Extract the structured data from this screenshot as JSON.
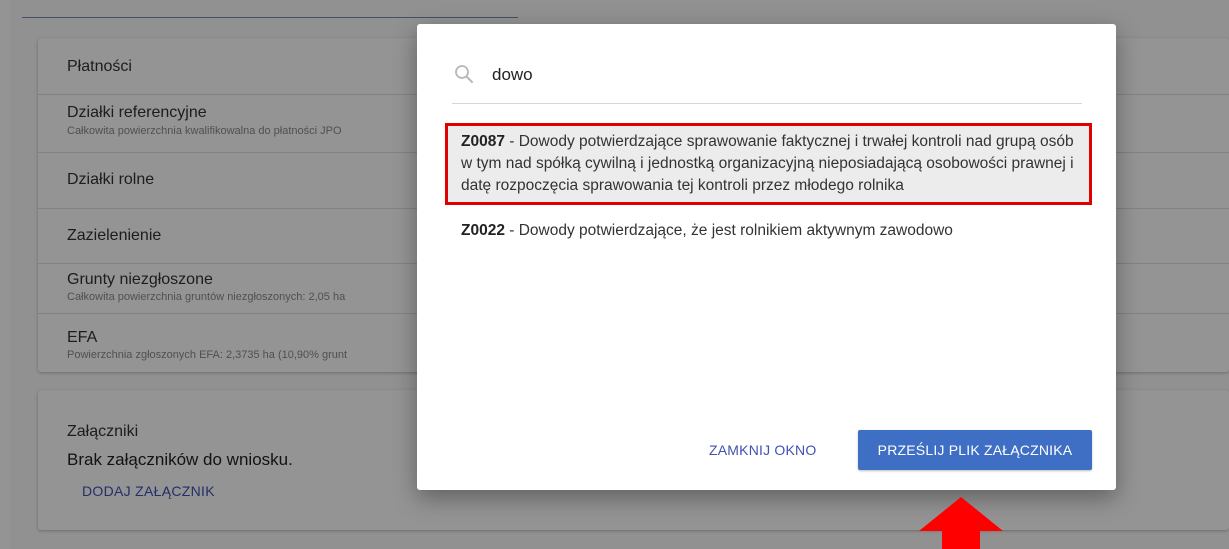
{
  "page": {
    "sections": [
      {
        "title": "Płatności",
        "subtitle": ""
      },
      {
        "title": "Działki referencyjne",
        "subtitle": "Całkowita powierzchnia kwalifikowalna do płatności JPO"
      },
      {
        "title": "Działki rolne",
        "subtitle": ""
      },
      {
        "title": "Zazielenienie",
        "subtitle": ""
      },
      {
        "title": "Grunty niezgłoszone",
        "subtitle": "Całkowita powierzchnia gruntów niezgłoszonych: 2,05 ha"
      },
      {
        "title": "EFA",
        "subtitle": "Powierzchnia zgłoszonych EFA: 2,3735 ha (10,90% grunt"
      }
    ],
    "attachments": {
      "title": "Załączniki",
      "empty_text": "Brak załączników do wniosku.",
      "add_label": "DODAJ ZAŁĄCZNIK"
    }
  },
  "dialog": {
    "search": {
      "value": "dowo",
      "icon": "search-icon"
    },
    "results": [
      {
        "code": "Z0087",
        "text": " - Dowody potwierdzające sprawowanie faktycznej i trwałej kontroli nad grupą osób w tym nad spółką cywilną i jednostką organizacyjną nieposiadającą osobowości prawnej i datę rozpoczęcia sprawowania tej kontroli przez młodego rolnika",
        "highlighted": true
      },
      {
        "code": "Z0022",
        "text": " - Dowody potwierdzające, że jest rolnikiem aktywnym zawodowo",
        "highlighted": false
      }
    ],
    "close_label": "ZAMKNIJ OKNO",
    "upload_label": "PRZEŚLIJ PLIK ZAŁĄCZNIKA"
  },
  "colors": {
    "accent": "#3f51b5",
    "button": "#3f6fc4",
    "highlight_border": "#e00000",
    "arrow": "#ff0000"
  }
}
